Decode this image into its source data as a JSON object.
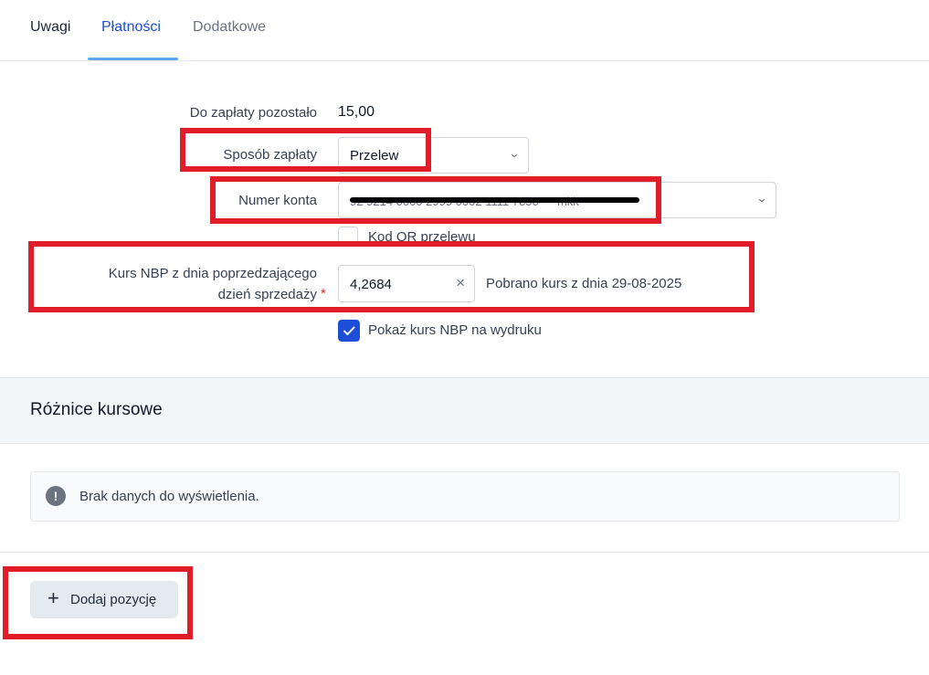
{
  "tabs": [
    {
      "label": "Uwagi"
    },
    {
      "label": "Płatności"
    },
    {
      "label": "Dodatkowe"
    }
  ],
  "payment": {
    "remaining_label": "Do zapłaty pozostało",
    "remaining_value": "15,00",
    "method_label": "Sposób zapłaty",
    "method_value": "Przelew",
    "account_label": "Numer konta",
    "account_value_redacted": "92 9214 0000 2999 0002 1111 7850 — mkk",
    "qr_label": "Kod QR przelewu",
    "nbp_label_line1": "Kurs NBP z dnia poprzedzającego",
    "nbp_label_line2": "dzień sprzedaży",
    "required_mark": "*",
    "nbp_rate": "4,2684",
    "nbp_fetched": "Pobrano kurs z dnia 29-08-2025",
    "show_rate_label": "Pokaż kurs NBP na wydruku",
    "show_rate_checked": true
  },
  "exchange_diff": {
    "title": "Różnice kursowe",
    "empty_text": "Brak danych do wyświetlenia."
  },
  "actions": {
    "add_item_label": "Dodaj pozycję"
  },
  "colors": {
    "accent": "#1d4ed8",
    "annotation": "#e11d2a"
  }
}
